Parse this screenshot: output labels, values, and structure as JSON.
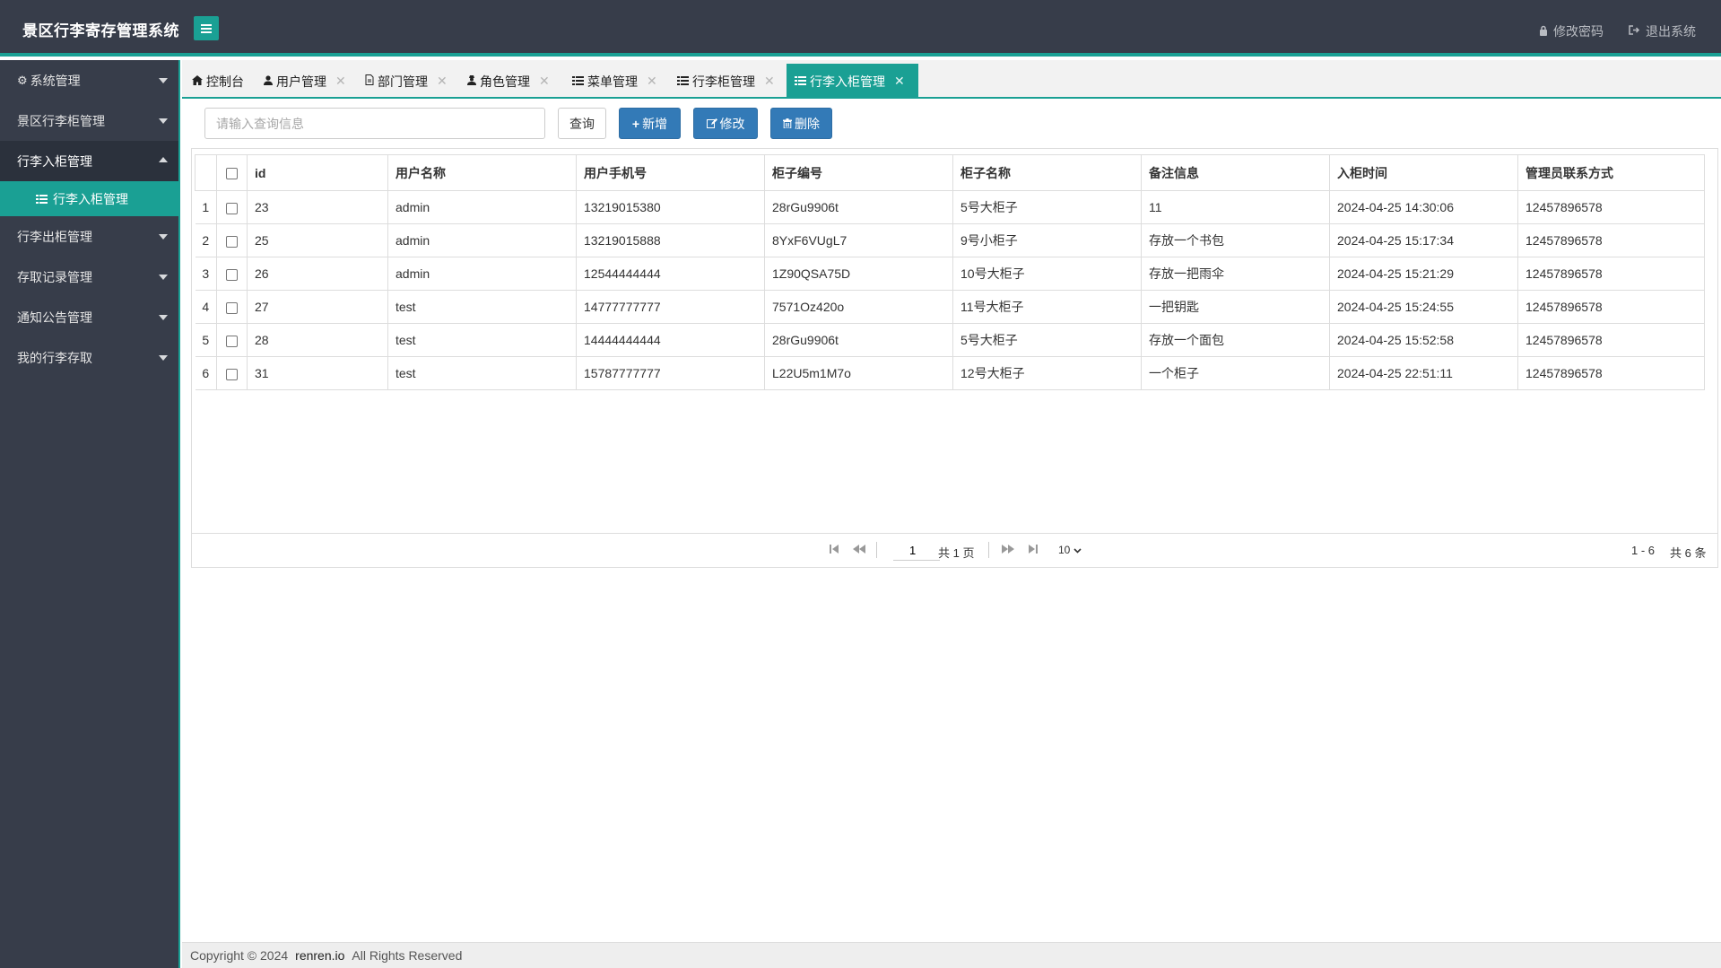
{
  "header": {
    "title": "景区行李寄存管理系统",
    "change_password": "修改密码",
    "logout": "退出系统"
  },
  "sidebar": {
    "items": [
      {
        "label": "系统管理",
        "icon": "gear-icon",
        "open": false
      },
      {
        "label": "景区行李柜管理",
        "open": false
      },
      {
        "label": "行李入柜管理",
        "open": true
      },
      {
        "label": "行李出柜管理",
        "open": false
      },
      {
        "label": "存取记录管理",
        "open": false
      },
      {
        "label": "通知公告管理",
        "open": false
      },
      {
        "label": "我的行李存取",
        "open": false
      }
    ],
    "active_sub": "行李入柜管理"
  },
  "tabs": [
    {
      "label": "控制台",
      "icon": "home-icon",
      "closable": false
    },
    {
      "label": "用户管理",
      "icon": "user-icon",
      "closable": true
    },
    {
      "label": "部门管理",
      "icon": "document-icon",
      "closable": true
    },
    {
      "label": "角色管理",
      "icon": "user-secret-icon",
      "closable": true
    },
    {
      "label": "菜单管理",
      "icon": "list-icon",
      "closable": true
    },
    {
      "label": "行李柜管理",
      "icon": "list-icon",
      "closable": true
    },
    {
      "label": "行李入柜管理",
      "icon": "list-icon",
      "closable": true,
      "active": true
    }
  ],
  "toolbar": {
    "search_placeholder": "请输入查询信息",
    "query": "查询",
    "add": "新增",
    "edit": "修改",
    "delete": "删除"
  },
  "table": {
    "columns": [
      "id",
      "用户名称",
      "用户手机号",
      "柜子编号",
      "柜子名称",
      "备注信息",
      "入柜时间",
      "管理员联系方式"
    ],
    "rows": [
      [
        "1",
        "23",
        "admin",
        "13219015380",
        "28rGu9906t",
        "5号大柜子",
        "11",
        "2024-04-25 14:30:06",
        "12457896578"
      ],
      [
        "2",
        "25",
        "admin",
        "13219015888",
        "8YxF6VUgL7",
        "9号小柜子",
        "存放一个书包",
        "2024-04-25 15:17:34",
        "12457896578"
      ],
      [
        "3",
        "26",
        "admin",
        "12544444444",
        "1Z90QSA75D",
        "10号大柜子",
        "存放一把雨伞",
        "2024-04-25 15:21:29",
        "12457896578"
      ],
      [
        "4",
        "27",
        "test",
        "14777777777",
        "7571Oz420o",
        "11号大柜子",
        "一把钥匙",
        "2024-04-25 15:24:55",
        "12457896578"
      ],
      [
        "5",
        "28",
        "test",
        "14444444444",
        "28rGu9906t",
        "5号大柜子",
        "存放一个面包",
        "2024-04-25 15:52:58",
        "12457896578"
      ],
      [
        "6",
        "31",
        "test",
        "15787777777",
        "L22U5m1M7o",
        "12号大柜子",
        "一个柜子",
        "2024-04-25 22:51:11",
        "12457896578"
      ]
    ]
  },
  "pagination": {
    "current_page": "1",
    "total_pages_text": "共 1 页",
    "page_size": "10",
    "range_text": "1 - 6",
    "total_text": "共 6 条"
  },
  "footer": {
    "copyright": "Copyright © 2024",
    "brand": "renren.io",
    "rights": "All Rights Reserved"
  },
  "colors": {
    "accent": "#1aa094",
    "sidebar_bg": "#373d4a",
    "primary_btn": "#337ab7"
  }
}
